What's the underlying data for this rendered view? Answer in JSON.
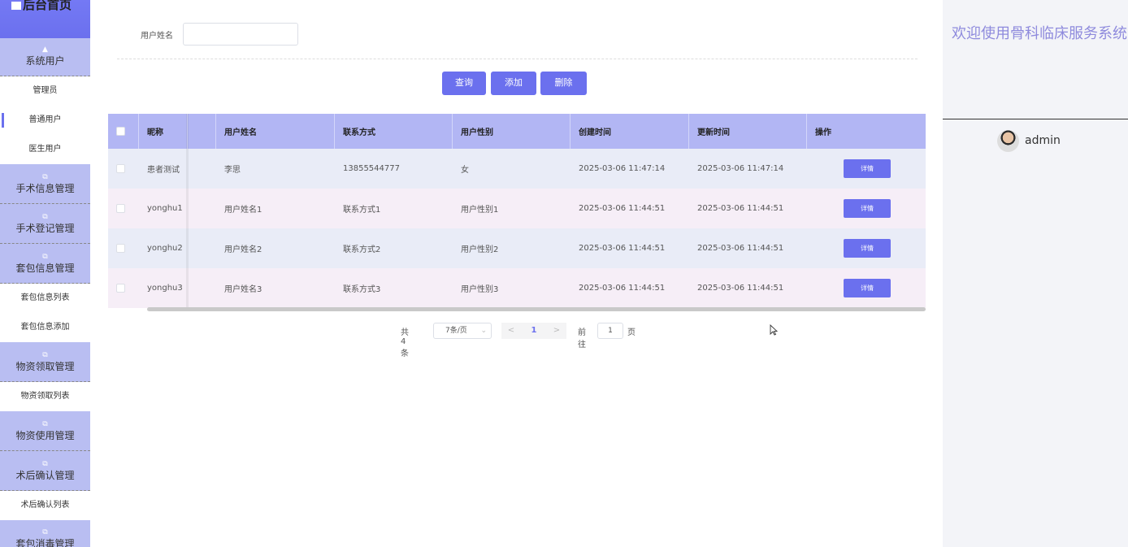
{
  "sidebar": {
    "home": "后台首页",
    "groups": [
      {
        "label": "系统用户",
        "items": [
          "管理员",
          "普通用户",
          "医生用户"
        ]
      },
      {
        "label": "手术信息管理",
        "items": []
      },
      {
        "label": "手术登记管理",
        "items": []
      },
      {
        "label": "套包信息管理",
        "items": [
          "套包信息列表",
          "套包信息添加"
        ]
      },
      {
        "label": "物资领取管理",
        "items": [
          "物资领取列表"
        ]
      },
      {
        "label": "物资使用管理",
        "items": []
      },
      {
        "label": "术后确认管理",
        "items": [
          "术后确认列表"
        ]
      },
      {
        "label": "套包消毒管理",
        "items": []
      }
    ]
  },
  "search": {
    "label": "用户姓名",
    "value": "",
    "placeholder": ""
  },
  "buttons": {
    "query": "查询",
    "add": "添加",
    "delete": "删除"
  },
  "table": {
    "headers": [
      "昵称",
      "用户姓名",
      "联系方式",
      "用户性别",
      "创建时间",
      "更新时间",
      "操作"
    ],
    "rows": [
      {
        "nick": "患者测试",
        "name": "李思",
        "phone": "13855544777",
        "gender": "女",
        "created": "2025-03-06 11:47:14",
        "updated": "2025-03-06 11:47:14",
        "action": "详情"
      },
      {
        "nick": "yonghu1",
        "name": "用户姓名1",
        "phone": "联系方式1",
        "gender": "用户性别1",
        "created": "2025-03-06 11:44:51",
        "updated": "2025-03-06 11:44:51",
        "action": "详情"
      },
      {
        "nick": "yonghu2",
        "name": "用户姓名2",
        "phone": "联系方式2",
        "gender": "用户性别2",
        "created": "2025-03-06 11:44:51",
        "updated": "2025-03-06 11:44:51",
        "action": "详情"
      },
      {
        "nick": "yonghu3",
        "name": "用户姓名3",
        "phone": "联系方式3",
        "gender": "用户性别3",
        "created": "2025-03-06 11:44:51",
        "updated": "2025-03-06 11:44:51",
        "action": "详情"
      }
    ]
  },
  "pagination": {
    "total": "共 4 条",
    "page_size": "7条/页",
    "prev": "<",
    "page": "1",
    "next": ">",
    "goto_label": "前往",
    "goto_value": "1",
    "goto_suffix": "页"
  },
  "header": {
    "welcome": "欢迎使用骨科临床服务系统",
    "username": "admin"
  },
  "colors": {
    "accent": "#6b70ee",
    "header_row": "#b2b6f4",
    "sidebar_group": "#b9bef2"
  },
  "icons": {
    "home": "home-icon",
    "user": "user-icon",
    "group": "external-link-icon"
  }
}
